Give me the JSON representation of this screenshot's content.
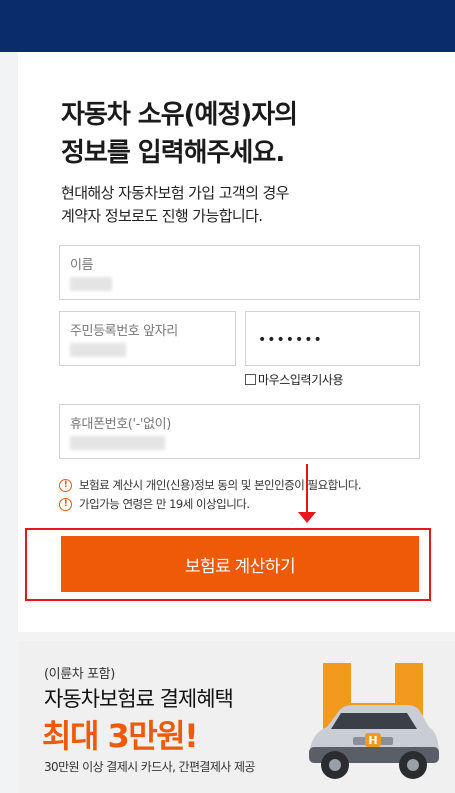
{
  "heading": {
    "line1": "자동차 소유(예정)자의",
    "line2": "정보를 입력해주세요."
  },
  "subtext": {
    "line1": "현대해상 자동차보험 가입 고객의 경우",
    "line2": "계약자 정보로도 진행 가능합니다."
  },
  "form": {
    "name_label": "이름",
    "rrn_front_label": "주민등록번호 앞자리",
    "rrn_back_masked": "•••••••",
    "mouse_input_label": "마우스입력기사용",
    "phone_label": "휴대폰번호('-'없이)"
  },
  "notices": [
    "보험료 계산시 개인(신용)정보 동의 및 본인인증이 필요합니다.",
    "가입가능 연령은 만 19세 이상입니다."
  ],
  "calc_button_label": "보험료 계산하기",
  "banner": {
    "small": "(이륜차 포함)",
    "title": "자동차보험료 결제혜택",
    "big": "최대 3만원!",
    "foot": "30만원 이상 결제시 카드사, 간편결제사 제공",
    "car_badge": "H"
  },
  "colors": {
    "header_navy": "#0b2c6b",
    "accent_orange": "#ee5a07",
    "highlight_red": "#e8161b"
  }
}
